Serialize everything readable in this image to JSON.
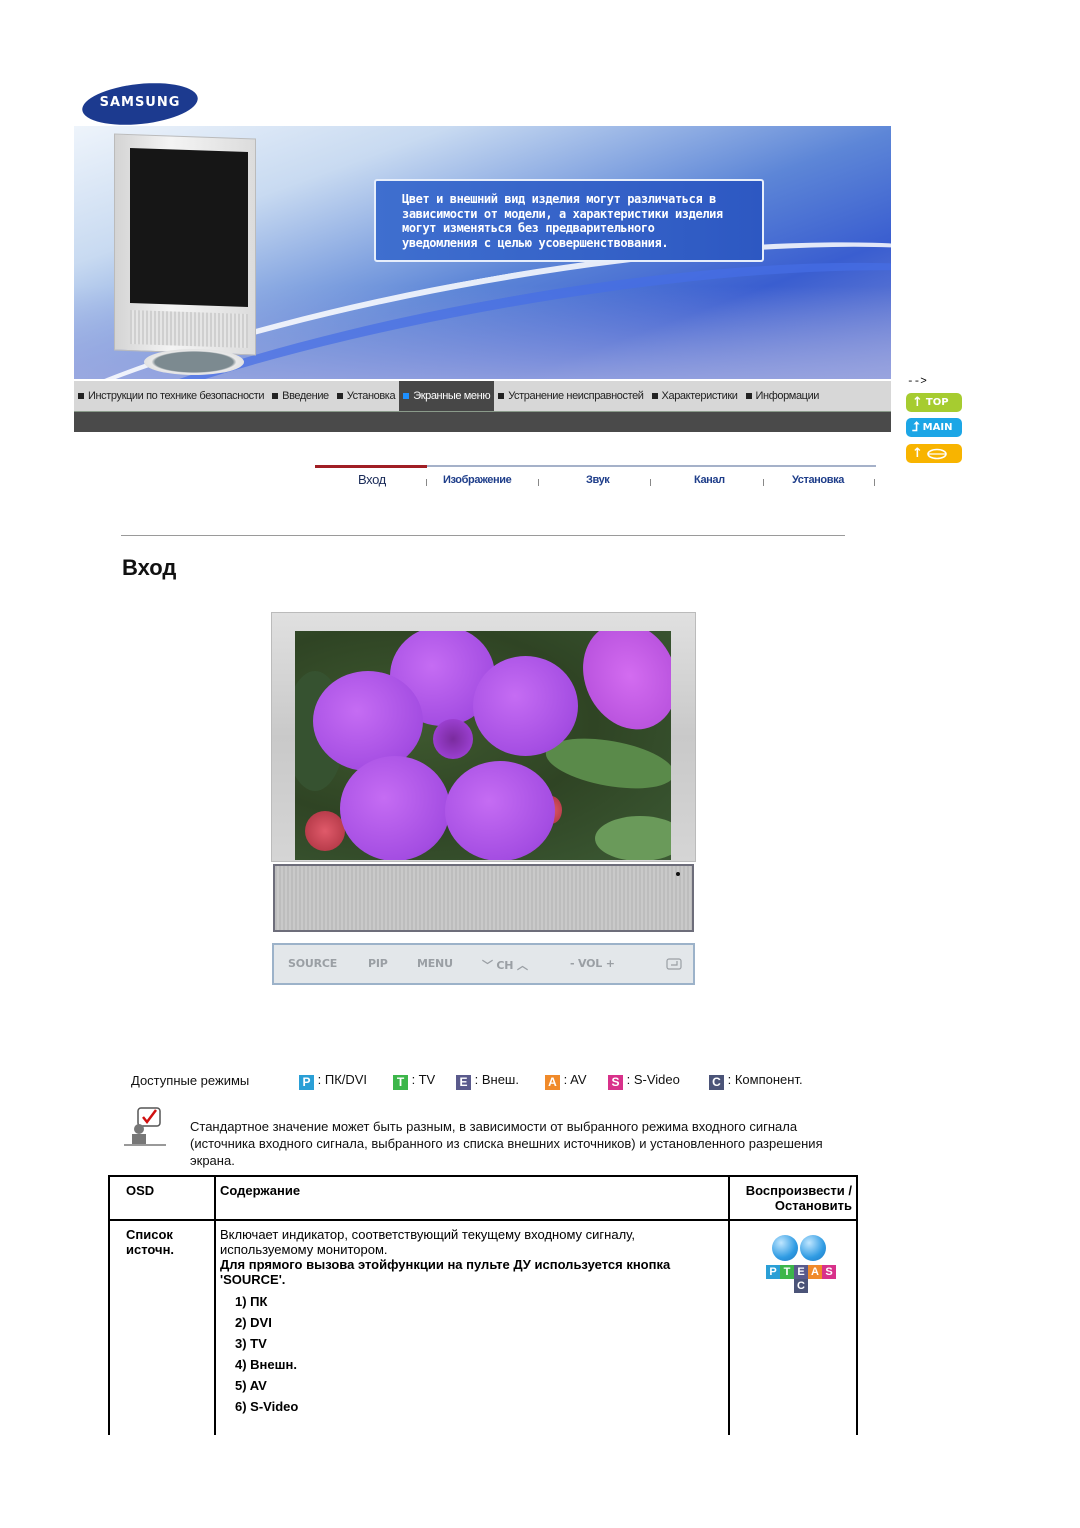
{
  "brand": {
    "logo_text": "SAMSUNG"
  },
  "banner": {
    "note_lines": [
      "Цвет и внешний вид изделия могут различаться в",
      "зависимости от модели, а характеристики изделия",
      "могут изменяться без предварительного",
      "уведомления с целью усовершенствования."
    ]
  },
  "top_nav": {
    "items": [
      {
        "label": "Инструкции по технике безопасности",
        "active": false
      },
      {
        "label": "Введение",
        "active": false
      },
      {
        "label": "Установка",
        "active": false
      },
      {
        "label": "Экранные меню",
        "active": true
      },
      {
        "label": "Устранение неисправностей",
        "active": false
      },
      {
        "label": "Характеристики",
        "active": false
      },
      {
        "label": "Информации",
        "active": false
      }
    ],
    "active_color": "#1e90ff"
  },
  "side_buttons": {
    "stray_text": "-->",
    "top_label": "TOP",
    "main_label": "MAIN",
    "third_label": "",
    "colors": {
      "top": "#a6cc30",
      "main": "#1ca6e6",
      "third": "#f8b400"
    }
  },
  "sub_tabs": {
    "items": [
      "Вход",
      "Изображение",
      "Звук",
      "Канал",
      "Установка"
    ],
    "active": "Вход",
    "accent_color": "#a01e24"
  },
  "page": {
    "title": "Вход"
  },
  "control_panel": {
    "labels": [
      "SOURCE",
      "PIP",
      "MENU",
      "﹀ CH ︿",
      "-  VOL +"
    ],
    "enter_icon": "enter-icon"
  },
  "modes": {
    "label": "Доступные режимы",
    "items": [
      {
        "badge": "P",
        "text": ": ПК/DVI",
        "color": "#2a9fd6"
      },
      {
        "badge": "T",
        "text": ": TV",
        "color": "#3cb64a"
      },
      {
        "badge": "E",
        "text": ": Внеш.",
        "color": "#5a5a8c"
      },
      {
        "badge": "A",
        "text": ": AV",
        "color": "#f08a2a"
      },
      {
        "badge": "S",
        "text": ": S-Video",
        "color": "#d8318a"
      },
      {
        "badge": "C",
        "text": ": Компонент.",
        "color": "#4b5478"
      }
    ]
  },
  "note": {
    "text": "Стандартное значение может быть разным, в зависимости от выбранного режима входного сигнала (источника входного сигнала, выбранного из списка внешних источников) и установленного разрешения экрана."
  },
  "table": {
    "headers": {
      "osd": "OSD",
      "content": "Содержание",
      "play": "Воспроизвести /Остановить"
    },
    "rows": [
      {
        "osd": "Список источн.",
        "desc": "Включает индикатор, соответствующий текущему входному сигналу, используемому монитором.",
        "bold_desc": "Для прямого вызова этойфункции на пульте ДУ используется кнопка 'SOURCE'.",
        "list": [
          "1) ПК",
          "2) DVI",
          "3) TV",
          "4) Внешн.",
          "5) AV",
          "6) S-Video"
        ],
        "play_tiles": [
          "P",
          "T",
          "E",
          "A",
          "S",
          "C"
        ]
      }
    ]
  }
}
